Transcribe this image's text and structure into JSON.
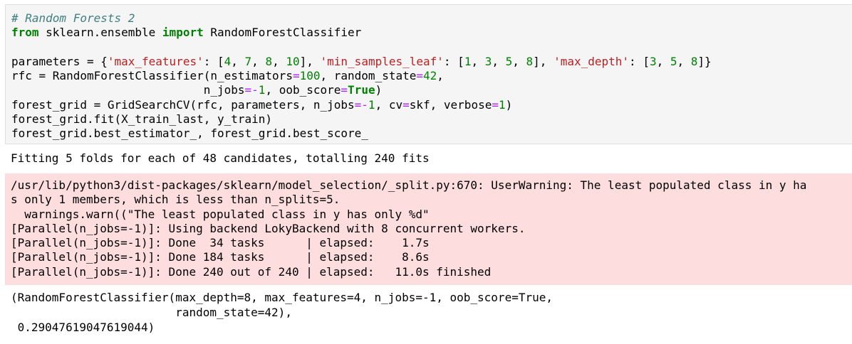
{
  "input_code": {
    "comment": "# Random Forests 2",
    "kw_from": "from",
    "module": " sklearn.ensemble ",
    "kw_import": "import",
    "import_name": " RandomForestClassifier",
    "params_prefix": "parameters = {",
    "key_max_features": "'max_features'",
    "mf_open": ": [",
    "mf_v1": "4",
    "mf_v2": "7",
    "mf_v3": "8",
    "mf_v4": "10",
    "mf_close": "], ",
    "key_min_samples_leaf": "'min_samples_leaf'",
    "msl_open": ": [",
    "msl_v1": "1",
    "msl_v2": "3",
    "msl_v3": "5",
    "msl_v4": "8",
    "msl_close": "], ",
    "key_max_depth": "'max_depth'",
    "md_open": ": [",
    "md_v1": "3",
    "md_v2": "5",
    "md_v3": "8",
    "md_close": "]}",
    "rfc_prefix": "rfc = RandomForestClassifier(n_estimators",
    "eq": "=",
    "rfc_n_est": "100",
    "rfc_mid": ", random_state",
    "rfc_rs": "42",
    "rfc_end1": ",",
    "rfc_line2_indent": "                            n_jobs",
    "minus": "-",
    "one": "1",
    "rfc_line2_mid": ", oob_score",
    "true": "True",
    "close_paren": ")",
    "grid_prefix": "forest_grid = GridSearchCV(rfc, parameters, n_jobs",
    "grid_mid": ", cv",
    "grid_cv": "skf",
    "grid_mid2": ", verbose",
    "fit_line": "forest_grid.fit(X_train_last, y_train)",
    "best_line": "forest_grid.best_estimator_, forest_grid.best_score_"
  },
  "stdout": "Fitting 5 folds for each of 48 candidates, totalling 240 fits",
  "stderr_lines": [
    "/usr/lib/python3/dist-packages/sklearn/model_selection/_split.py:670: UserWarning: The least populated class in y ha",
    "s only 1 members, which is less than n_splits=5.",
    "  warnings.warn((\"The least populated class in y has only %d\"",
    "[Parallel(n_jobs=-1)]: Using backend LokyBackend with 8 concurrent workers.",
    "[Parallel(n_jobs=-1)]: Done  34 tasks      | elapsed:    1.7s",
    "[Parallel(n_jobs=-1)]: Done 184 tasks      | elapsed:    8.6s",
    "[Parallel(n_jobs=-1)]: Done 240 out of 240 | elapsed:   11.0s finished"
  ],
  "result_lines": [
    "(RandomForestClassifier(max_depth=8, max_features=4, n_jobs=-1, oob_score=True,",
    "                        random_state=42),",
    " 0.29047619047619044)"
  ]
}
